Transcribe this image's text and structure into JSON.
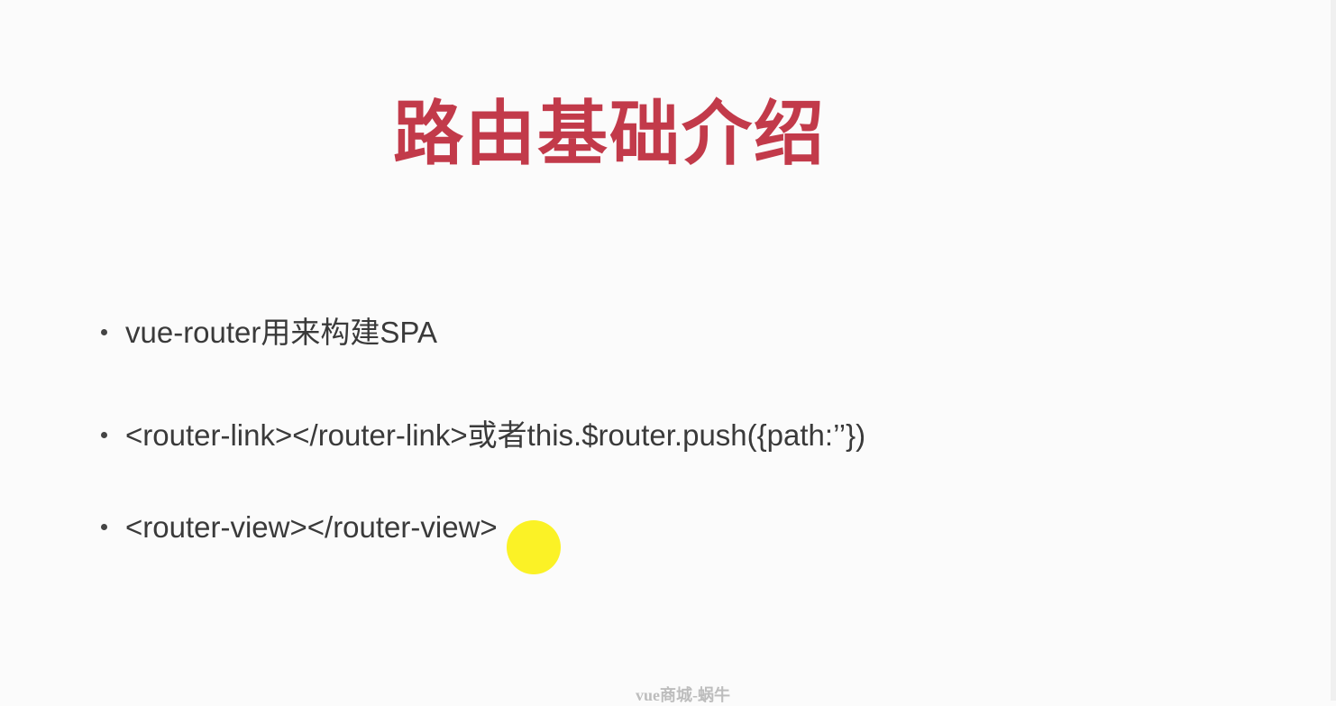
{
  "slide": {
    "title": "路由基础介绍",
    "bullets": [
      "vue-router用来构建SPA",
      "<router-link></router-link>或者this.$router.push({path:’’})",
      "<router-view></router-view>"
    ],
    "footer": "vue商城-蜗牛"
  },
  "colors": {
    "title": "#c23a4a",
    "text": "#3a3a3a",
    "pointer": "#faf000"
  }
}
